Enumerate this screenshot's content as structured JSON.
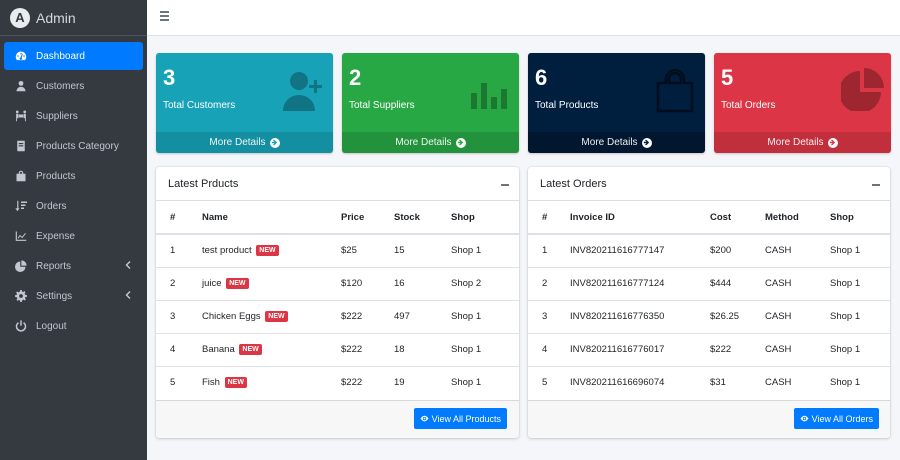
{
  "brand": {
    "name": "Admin",
    "logo_letter": "A"
  },
  "sidebar": {
    "items": [
      {
        "label": "Dashboard",
        "icon": "dashboard-icon",
        "active": true
      },
      {
        "label": "Customers",
        "icon": "user-icon"
      },
      {
        "label": "Suppliers",
        "icon": "people-carry-icon"
      },
      {
        "label": "Products Category",
        "icon": "book-icon"
      },
      {
        "label": "Products",
        "icon": "shopping-bag-icon"
      },
      {
        "label": "Orders",
        "icon": "sort-list-icon"
      },
      {
        "label": "Expense",
        "icon": "line-chart-icon"
      },
      {
        "label": "Reports",
        "icon": "pie-chart-icon",
        "caret": true
      },
      {
        "label": "Settings",
        "icon": "gear-icon",
        "caret": true
      },
      {
        "label": "Logout",
        "icon": "power-icon"
      }
    ]
  },
  "stats": [
    {
      "value": "3",
      "label": "Total Customers",
      "footer": "More Details",
      "color": "#17a2b8",
      "icon": "user-plus-icon"
    },
    {
      "value": "2",
      "label": "Total Suppliers",
      "footer": "More Details",
      "color": "#28a745",
      "icon": "bar-chart-icon"
    },
    {
      "value": "6",
      "label": "Total Products",
      "footer": "More Details",
      "color": "#001f3f",
      "icon": "shopping-bag-icon"
    },
    {
      "value": "5",
      "label": "Total Orders",
      "footer": "More Details",
      "color": "#dc3545",
      "icon": "pie-chart-icon"
    }
  ],
  "products_card": {
    "title": "Latest Prducts",
    "badge": "NEW",
    "columns": [
      "#",
      "Name",
      "Price",
      "Stock",
      "Shop"
    ],
    "rows": [
      [
        "1",
        "test product",
        "$25",
        "15",
        "Shop 1"
      ],
      [
        "2",
        "juice",
        "$120",
        "16",
        "Shop 2"
      ],
      [
        "3",
        "Chicken Eggs",
        "$222",
        "497",
        "Shop 1"
      ],
      [
        "4",
        "Banana",
        "$222",
        "18",
        "Shop 1"
      ],
      [
        "5",
        "Fish",
        "$222",
        "19",
        "Shop 1"
      ]
    ],
    "button": "View All Products"
  },
  "orders_card": {
    "title": "Latest Orders",
    "columns": [
      "#",
      "Invoice ID",
      "Cost",
      "Method",
      "Shop"
    ],
    "rows": [
      [
        "1",
        "INV820211616777147",
        "$200",
        "CASH",
        "Shop 1"
      ],
      [
        "2",
        "INV820211616777124",
        "$444",
        "CASH",
        "Shop 1"
      ],
      [
        "3",
        "INV820211616776350",
        "$26.25",
        "CASH",
        "Shop 1"
      ],
      [
        "4",
        "INV820211616776017",
        "$222",
        "CASH",
        "Shop 1"
      ],
      [
        "5",
        "INV820211616696074",
        "$31",
        "CASH",
        "Shop 1"
      ]
    ],
    "button": "View All Orders"
  }
}
